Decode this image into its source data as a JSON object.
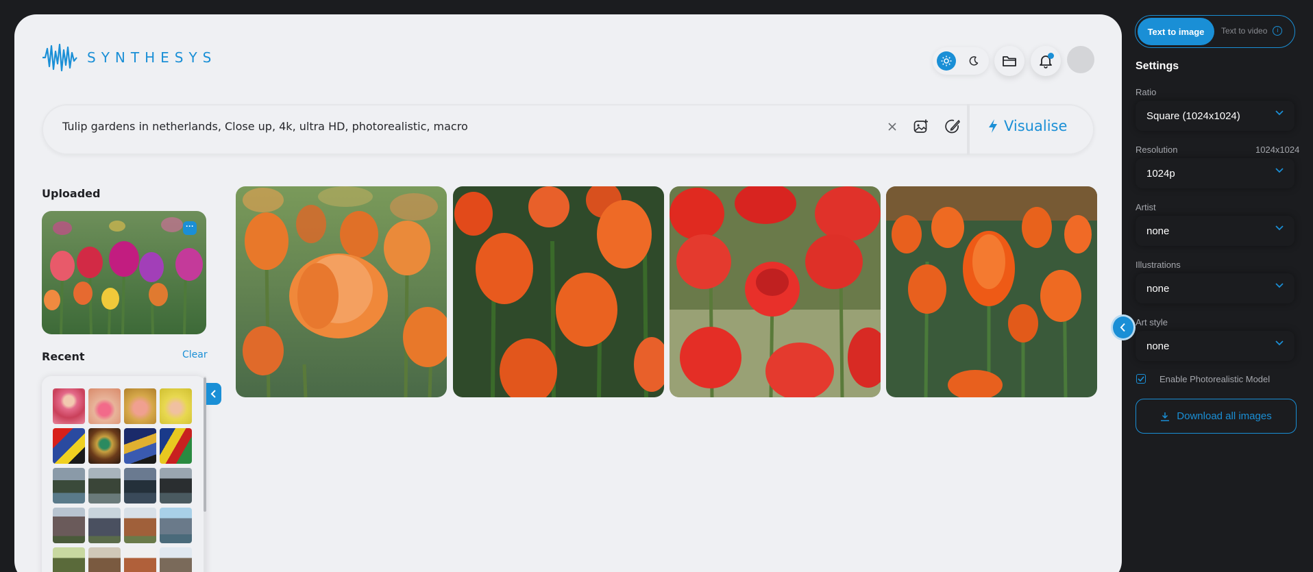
{
  "brand": {
    "name": "SYNTHESYS"
  },
  "colors": {
    "accent": "#1a8fd6",
    "canvas": "#eff0f3",
    "panel": "#1b1c1f"
  },
  "header": {
    "theme": {
      "light_icon": "sun-icon",
      "dark_icon": "moon-icon",
      "active": "light"
    },
    "folder_icon": "folder-icon",
    "bell_icon": "bell-icon"
  },
  "prompt": {
    "text": "Tulip gardens in netherlands, Close up, 4k, ultra HD, photorealistic, macro",
    "visualise_label": "Visualise"
  },
  "sidebar": {
    "uploaded_title": "Uploaded",
    "recent_title": "Recent",
    "clear_label": "Clear"
  },
  "settings": {
    "mode_active": "Text to image",
    "mode_inactive": "Text to video",
    "title": "Settings",
    "ratio": {
      "label": "Ratio",
      "value": "Square (1024x1024)"
    },
    "resolution": {
      "label": "Resolution",
      "value": "1024p",
      "extra": "1024x1024"
    },
    "artist": {
      "label": "Artist",
      "value": "none"
    },
    "illustrations": {
      "label": "Illustrations",
      "value": "none"
    },
    "art_style": {
      "label": "Art style",
      "value": "none"
    },
    "photoreal_label": "Enable Photorealistic Model",
    "photoreal_checked": true,
    "download_label": "Download all images"
  }
}
